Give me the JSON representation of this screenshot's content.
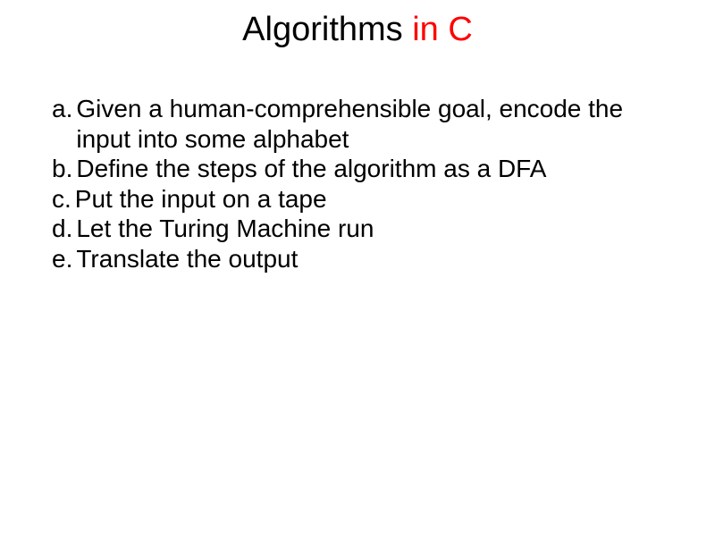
{
  "title": {
    "part1": "Algorithms ",
    "part2": "in C"
  },
  "items": [
    {
      "label": "a.",
      "text": "Given a human-comprehensible goal, encode the input into some alphabet"
    },
    {
      "label": "b.",
      "text": "Define the steps of the algorithm as a DFA"
    },
    {
      "label": "c.",
      "text": "Put the input on a tape"
    },
    {
      "label": "d.",
      "text": "Let the Turing Machine run"
    },
    {
      "label": "e.",
      "text": "Translate the output"
    }
  ]
}
